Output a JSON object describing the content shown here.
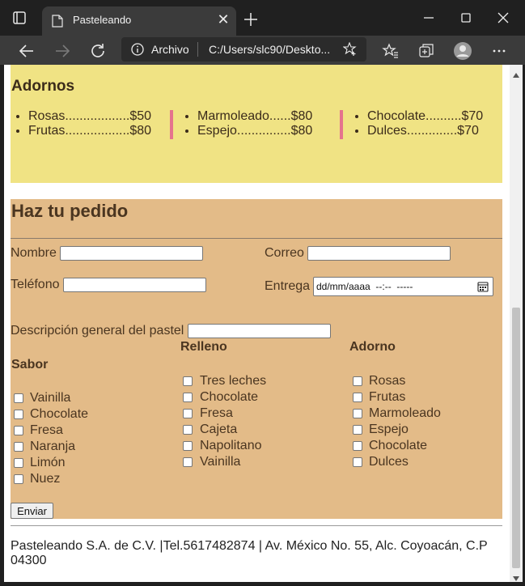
{
  "browser": {
    "tab_title": "Pasteleando",
    "address_label": "Archivo",
    "address_url": "C:/Users/slc90/Deskto..."
  },
  "adornos": {
    "title": "Adornos",
    "columns": [
      [
        {
          "text": "Rosas..................$50"
        },
        {
          "text": "Frutas..................$80"
        }
      ],
      [
        {
          "text": "Marmoleado......$80"
        },
        {
          "text": "Espejo...............$80"
        }
      ],
      [
        {
          "text": "Chocolate..........$70"
        },
        {
          "text": "Dulces..............$70"
        }
      ]
    ]
  },
  "pedido": {
    "title": "Haz tu pedido",
    "nombre_label": "Nombre",
    "correo_label": "Correo",
    "telefono_label": "Teléfono",
    "entrega_label": "Entrega",
    "entrega_placeholder": "dd/mm/aaaa  --:--  -----",
    "descripcion_label": "Descripción general del pastel",
    "sabor_title": "Sabor",
    "relleno_title": "Relleno",
    "adorno_title": "Adorno",
    "sabor_options": [
      "Vainilla",
      "Chocolate",
      "Fresa",
      "Naranja",
      "Limón",
      "Nuez"
    ],
    "relleno_options": [
      "Tres leches",
      "Chocolate",
      "Fresa",
      "Cajeta",
      "Napolitano",
      "Vainilla"
    ],
    "adorno_options": [
      "Rosas",
      "Frutas",
      "Marmoleado",
      "Espejo",
      "Chocolate",
      "Dulces"
    ],
    "submit_label": "Enviar"
  },
  "footer": {
    "text": "Pasteleando S.A. de C.V. |Tel.5617482874 | Av. México No. 55, Alc. Coyoacán, C.P 04300"
  },
  "colors": {
    "adornos_bg": "#f0e384",
    "pedido_bg": "#e3bb88",
    "divider": "#e5738d"
  }
}
